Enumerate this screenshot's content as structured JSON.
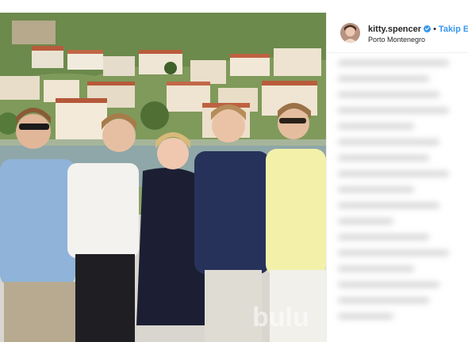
{
  "post": {
    "username": "kitty.spencer",
    "separator": "•",
    "follow_label": "Takip Et",
    "location": "Porto Montenegro"
  },
  "watermark": "bulu",
  "colors": {
    "accent": "#3897f0",
    "verified_badge": "#3897f0"
  },
  "icons": {
    "verified": "verified-badge-icon"
  }
}
